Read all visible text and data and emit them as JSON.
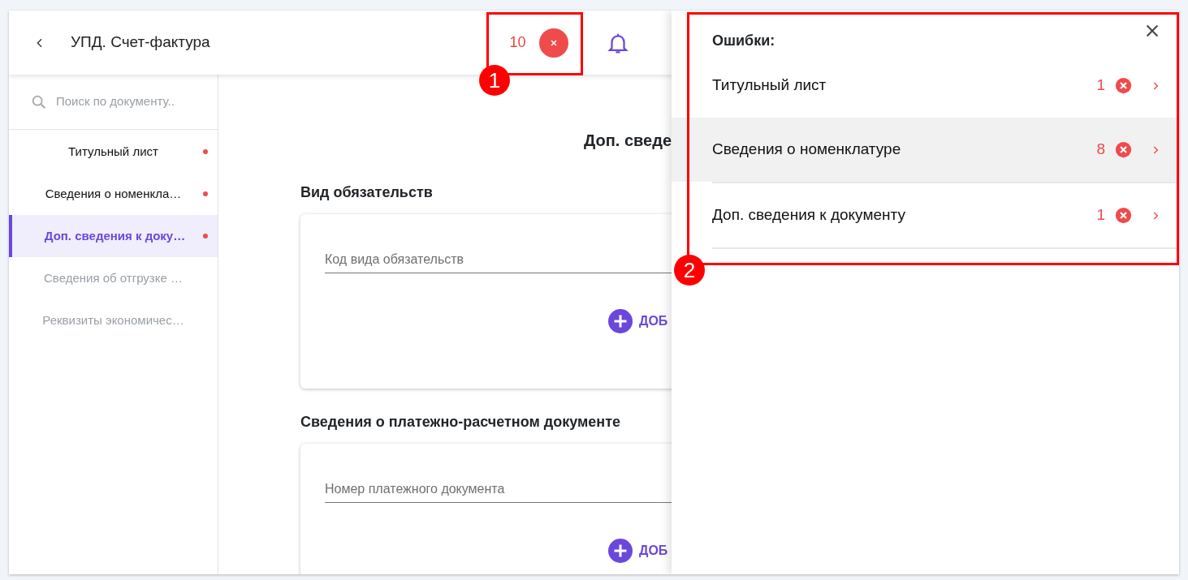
{
  "header": {
    "title": "УПД. Счет-фактура",
    "error_count": "10"
  },
  "sidebar": {
    "search": {
      "placeholder": "Поиск по документу.."
    },
    "items": [
      {
        "label": "Титульный лист",
        "selected": false,
        "has_error": true,
        "disabled": false
      },
      {
        "label": "Сведения о номенкла…",
        "selected": false,
        "has_error": true,
        "disabled": false
      },
      {
        "label": "Доп. сведения к доку…",
        "selected": true,
        "has_error": true,
        "disabled": false
      },
      {
        "label": "Сведения об отгрузке …",
        "selected": false,
        "has_error": false,
        "disabled": true
      },
      {
        "label": "Реквизиты экономичес…",
        "selected": false,
        "has_error": false,
        "disabled": true
      }
    ]
  },
  "main": {
    "title": "Доп. сведе",
    "sections": [
      {
        "title": "Вид обязательств",
        "field": {
          "placeholder": "Код вида обязательств"
        },
        "add_button": "ДОБ"
      },
      {
        "title": "Сведения о платежно-расчетном документе",
        "field": {
          "placeholder": "Номер платежного документа"
        },
        "add_button": "ДОБ"
      }
    ]
  },
  "errors_panel": {
    "title": "Ошибки:",
    "items": [
      {
        "label": "Титульный лист",
        "count": "1",
        "hovered": false
      },
      {
        "label": "Сведения о номенклатуре",
        "count": "8",
        "hovered": true
      },
      {
        "label": "Доп. сведения к документу",
        "count": "1",
        "hovered": false
      }
    ]
  },
  "annotations": [
    {
      "label": "1"
    },
    {
      "label": "2"
    }
  ]
}
